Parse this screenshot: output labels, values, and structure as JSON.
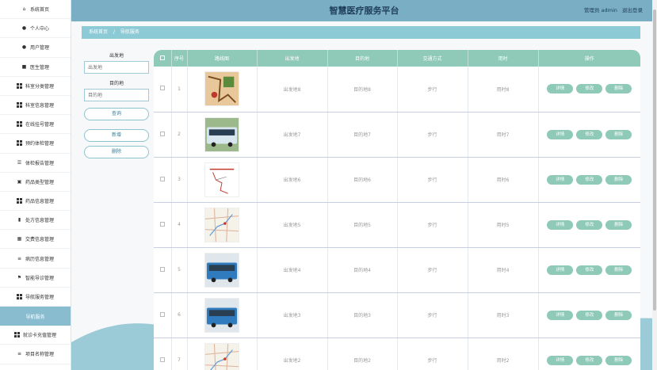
{
  "sidebar": {
    "items": [
      {
        "label": "系统首页",
        "icon": "home-icon",
        "glyph": "⌂",
        "active": false
      },
      {
        "label": "个人中心",
        "icon": "user-icon",
        "glyph": "●",
        "active": false
      },
      {
        "label": "用户管理",
        "icon": "user-icon",
        "glyph": "●",
        "active": false
      },
      {
        "label": "医生管理",
        "icon": "doctor-icon",
        "glyph": "■",
        "active": false
      },
      {
        "label": "科室分类管理",
        "icon": "grid-icon",
        "glyph": "grid",
        "active": false
      },
      {
        "label": "科室信息管理",
        "icon": "grid-icon",
        "glyph": "grid",
        "active": false
      },
      {
        "label": "在线挂号管理",
        "icon": "grid-icon",
        "glyph": "grid",
        "active": false
      },
      {
        "label": "预约体检管理",
        "icon": "grid-icon",
        "glyph": "grid",
        "active": false
      },
      {
        "label": "体检报告管理",
        "icon": "report-icon",
        "glyph": "☰",
        "active": false
      },
      {
        "label": "药品类型管理",
        "icon": "medicine-icon",
        "glyph": "▣",
        "active": false
      },
      {
        "label": "药品信息管理",
        "icon": "grid-icon",
        "glyph": "grid",
        "active": false
      },
      {
        "label": "处方信息管理",
        "icon": "prescription-icon",
        "glyph": "▮",
        "active": false
      },
      {
        "label": "交费信息管理",
        "icon": "table-icon",
        "glyph": "▦",
        "active": false
      },
      {
        "label": "病历信息管理",
        "icon": "list-icon",
        "glyph": "≡",
        "active": false
      },
      {
        "label": "智能导诊管理",
        "icon": "flag-icon",
        "glyph": "⚑",
        "active": false
      },
      {
        "label": "导航服务管理",
        "icon": "grid-icon",
        "glyph": "grid",
        "active": false
      },
      {
        "label": "导航服务",
        "icon": "",
        "glyph": "",
        "active": true
      },
      {
        "label": "就诊卡充值管理",
        "icon": "grid-icon",
        "glyph": "grid",
        "active": false
      },
      {
        "label": "项目名称管理",
        "icon": "menu-icon",
        "glyph": "≡",
        "active": false
      }
    ]
  },
  "header": {
    "title": "智慧医疗服务平台",
    "user_text": "管理员 admin",
    "logout": "退出登录"
  },
  "breadcrumb": {
    "home": "系统首页",
    "separator": "/",
    "current": "导航服务"
  },
  "search": {
    "origin_label": "出发地",
    "origin_placeholder": "出发地",
    "destination_label": "目的地",
    "destination_placeholder": "目的地",
    "query_button": "查询",
    "add_button": "新增",
    "delete_button": "删除"
  },
  "table": {
    "headers": [
      "",
      "序号",
      "路线图",
      "出发地",
      "目的地",
      "交通方式",
      "用时",
      "操作"
    ],
    "action_labels": {
      "detail": "详情",
      "edit": "修改",
      "delete": "删除"
    },
    "rows": [
      {
        "index": "1",
        "image": "map",
        "origin": "出发地8",
        "destination": "目的地8",
        "transport": "步行",
        "duration": "用时8"
      },
      {
        "index": "2",
        "image": "bus",
        "origin": "出发地7",
        "destination": "目的地7",
        "transport": "步行",
        "duration": "用时7"
      },
      {
        "index": "3",
        "image": "route",
        "origin": "出发地6",
        "destination": "目的地6",
        "transport": "步行",
        "duration": "用时6"
      },
      {
        "index": "4",
        "image": "citymap",
        "origin": "出发地5",
        "destination": "目的地5",
        "transport": "步行",
        "duration": "用时5"
      },
      {
        "index": "5",
        "image": "bus2",
        "origin": "出发地4",
        "destination": "目的地4",
        "transport": "步行",
        "duration": "用时4"
      },
      {
        "index": "6",
        "image": "bus2",
        "origin": "出发地3",
        "destination": "目的地3",
        "transport": "步行",
        "duration": "用时3"
      },
      {
        "index": "7",
        "image": "citymap",
        "origin": "出发地2",
        "destination": "目的地2",
        "transport": "步行",
        "duration": "用时2"
      }
    ]
  },
  "colors": {
    "header_bg": "#7aaec4",
    "accent": "#8fc9b7",
    "crumb_bg": "#8ccad6",
    "active_item": "#89bccf"
  }
}
